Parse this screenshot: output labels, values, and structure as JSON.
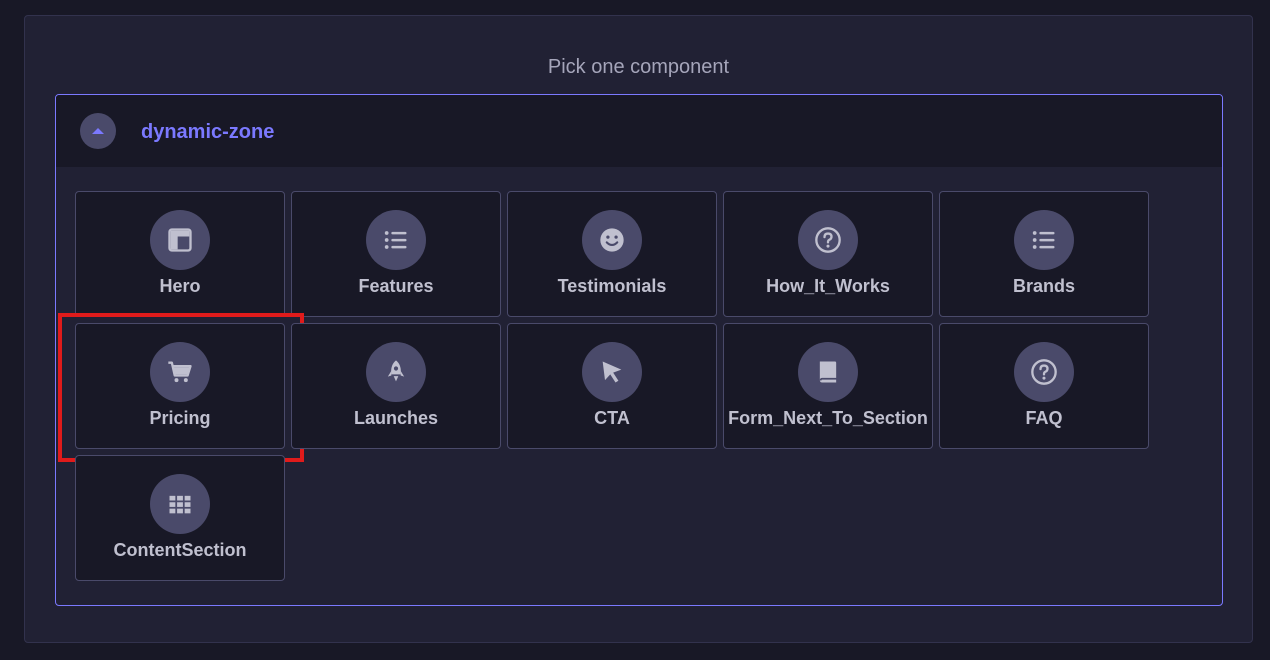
{
  "panel": {
    "title": "Pick one component"
  },
  "zone": {
    "name": "dynamic-zone",
    "toggle_icon": "chevron-up-icon"
  },
  "components": [
    {
      "label": "Hero",
      "icon": "layout-icon"
    },
    {
      "label": "Features",
      "icon": "list-icon"
    },
    {
      "label": "Testimonials",
      "icon": "smile-icon"
    },
    {
      "label": "How_It_Works",
      "icon": "question-icon"
    },
    {
      "label": "Brands",
      "icon": "list-icon"
    },
    {
      "label": "Pricing",
      "icon": "cart-icon",
      "highlighted": true
    },
    {
      "label": "Launches",
      "icon": "rocket-icon"
    },
    {
      "label": "CTA",
      "icon": "cursor-icon"
    },
    {
      "label": "Form_Next_To_Section",
      "icon": "book-icon"
    },
    {
      "label": "FAQ",
      "icon": "question-icon"
    },
    {
      "label": "ContentSection",
      "icon": "grid-icon"
    }
  ],
  "colors": {
    "accent": "#7b79ff",
    "highlight": "#e01b1b"
  }
}
